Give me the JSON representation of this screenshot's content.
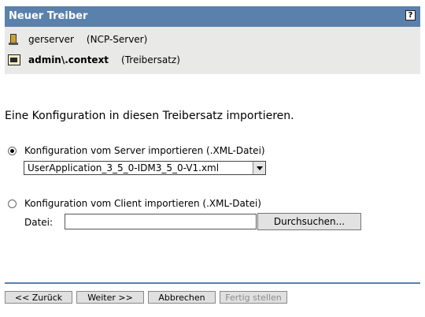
{
  "header": {
    "title": "Neuer Treiber",
    "help_glyph": "?"
  },
  "info": {
    "server_name": "gerserver",
    "server_type": "(NCP-Server)",
    "driverset_name": "admin\\.context",
    "driverset_type": "(Treibersatz)"
  },
  "intro_text": "Eine Konfiguration in diesen Treibersatz importieren.",
  "options": {
    "server": {
      "label": "Konfiguration vom Server importieren (.XML-Datei)",
      "selected": true,
      "select_value": "UserApplication_3_5_0-IDM3_5_0-V1.xml"
    },
    "client": {
      "label": "Konfiguration vom Client importieren (.XML-Datei)",
      "selected": false,
      "file_label": "Datei:",
      "file_value": "",
      "browse_label": "Durchsuchen..."
    }
  },
  "nav": {
    "back": "<< Zurück",
    "next": "Weiter >>",
    "cancel": "Abbrechen",
    "finish": "Fertig stellen",
    "finish_disabled": true
  },
  "colors": {
    "header_bg": "#5a80ac",
    "info_bg": "#e9e9e7",
    "disabled_text": "#8c8c8c"
  }
}
